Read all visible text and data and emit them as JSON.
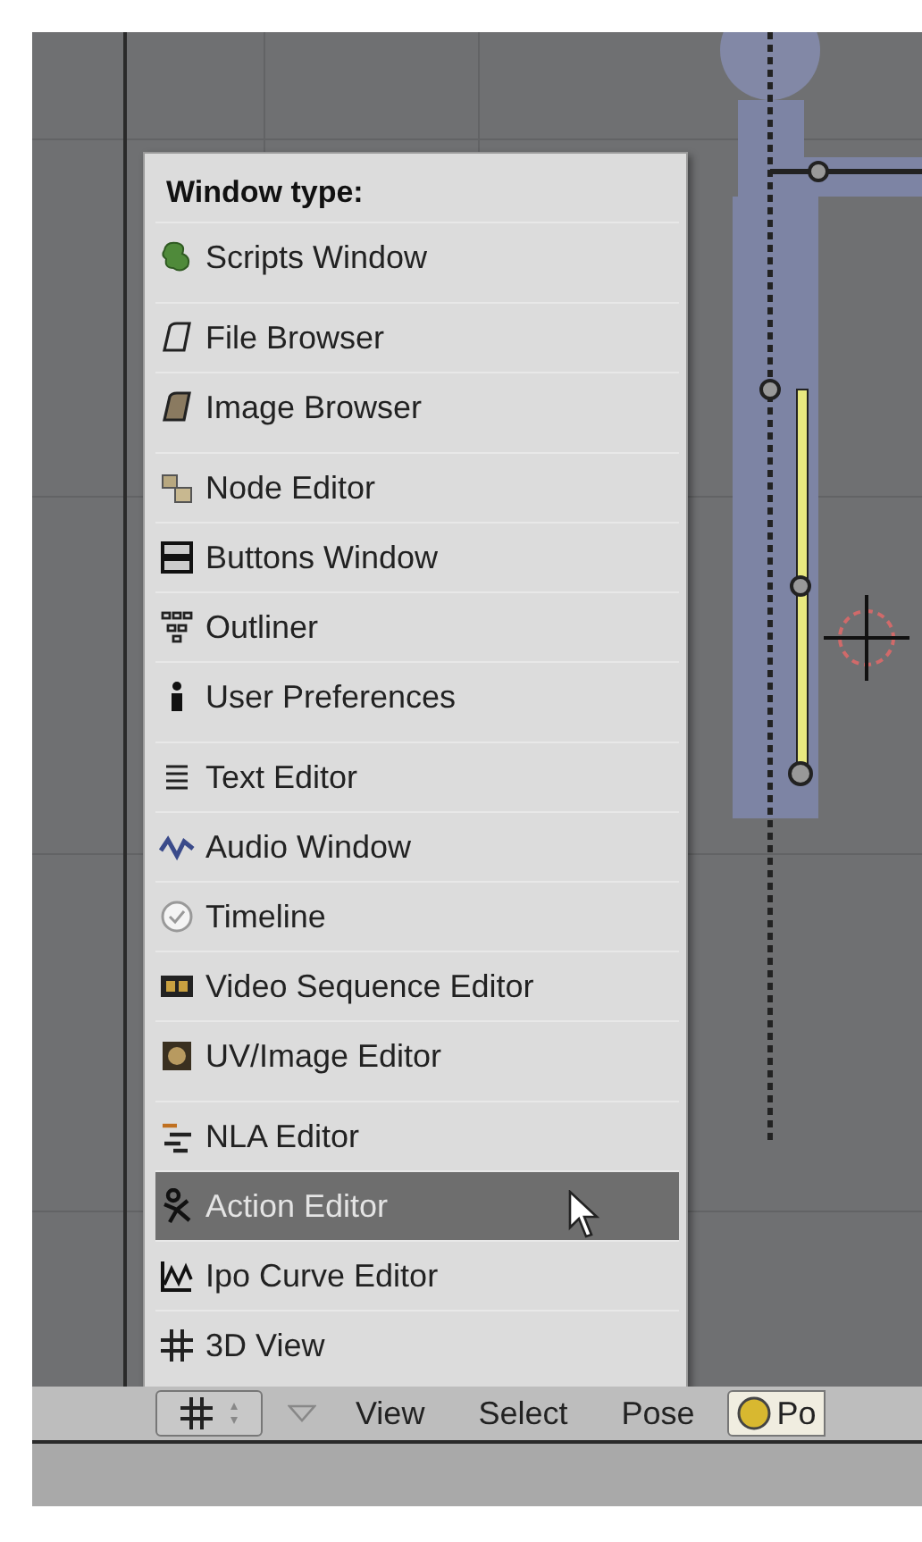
{
  "menu": {
    "title": "Window type:",
    "items": [
      {
        "label": "Scripts Window",
        "selected": false
      },
      {
        "label": "File Browser",
        "selected": false
      },
      {
        "label": "Image Browser",
        "selected": false
      },
      {
        "label": "Node Editor",
        "selected": false
      },
      {
        "label": "Buttons Window",
        "selected": false
      },
      {
        "label": "Outliner",
        "selected": false
      },
      {
        "label": "User Preferences",
        "selected": false
      },
      {
        "label": "Text Editor",
        "selected": false
      },
      {
        "label": "Audio Window",
        "selected": false
      },
      {
        "label": "Timeline",
        "selected": false
      },
      {
        "label": "Video Sequence Editor",
        "selected": false
      },
      {
        "label": "UV/Image Editor",
        "selected": false
      },
      {
        "label": "NLA Editor",
        "selected": false
      },
      {
        "label": "Action Editor",
        "selected": true
      },
      {
        "label": "Ipo Curve Editor",
        "selected": false
      },
      {
        "label": "3D View",
        "selected": false
      }
    ]
  },
  "header": {
    "menus": [
      "View",
      "Select",
      "Pose"
    ],
    "mode_button": {
      "label": "Po"
    }
  }
}
